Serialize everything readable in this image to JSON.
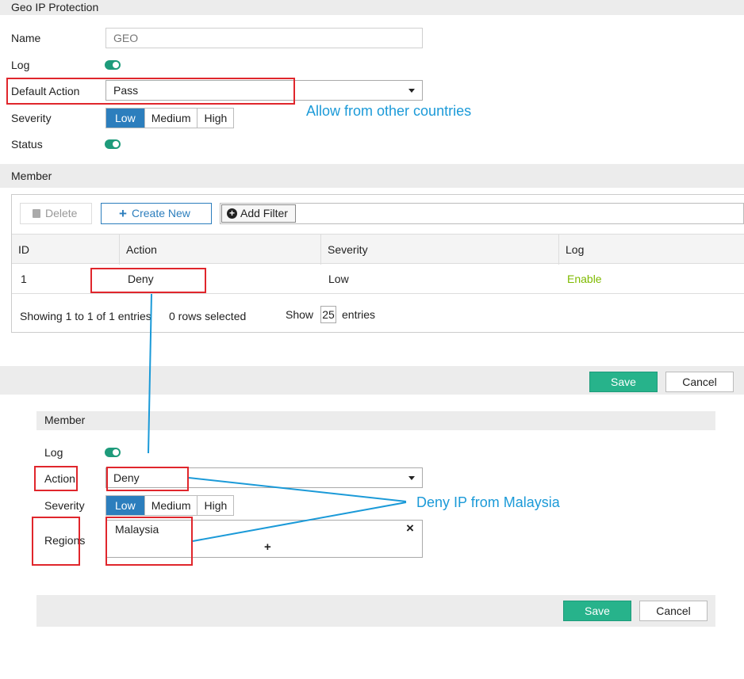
{
  "section_title": "Geo IP Protection",
  "form": {
    "name_label": "Name",
    "name_value": "GEO",
    "log_label": "Log",
    "default_action_label": "Default Action",
    "default_action_value": "Pass",
    "severity_label": "Severity",
    "severity_options": [
      "Low",
      "Medium",
      "High"
    ],
    "severity_selected": "Low",
    "status_label": "Status"
  },
  "annotation_allow": "Allow from other countries",
  "member": {
    "title": "Member",
    "toolbar": {
      "delete": "Delete",
      "create_new": "Create New",
      "add_filter": "Add Filter"
    },
    "columns": [
      "ID",
      "Action",
      "Severity",
      "Log"
    ],
    "rows": [
      {
        "id": "1",
        "action": "Deny",
        "severity": "Low",
        "log": "Enable"
      }
    ],
    "footer": {
      "showing": "Showing 1 to 1 of 1 entries",
      "selected": "0 rows selected",
      "show": "Show",
      "page_size": "25",
      "entries": "entries"
    }
  },
  "buttons": {
    "save": "Save",
    "cancel": "Cancel"
  },
  "member_dialog": {
    "title": "Member",
    "log_label": "Log",
    "action_label": "Action",
    "action_value": "Deny",
    "severity_label": "Severity",
    "severity_options": [
      "Low",
      "Medium",
      "High"
    ],
    "severity_selected": "Low",
    "regions_label": "Regions",
    "regions": [
      "Malaysia"
    ],
    "add_symbol": "+",
    "remove_symbol": "×"
  },
  "annotation_deny": "Deny IP  from Malaysia",
  "colors": {
    "primary": "#2c7ebd",
    "save": "#27b38b",
    "toggle": "#1e9b7b",
    "annotation": "#1b9ad8",
    "highlight": "#e0262c",
    "enable": "#7fba00"
  }
}
